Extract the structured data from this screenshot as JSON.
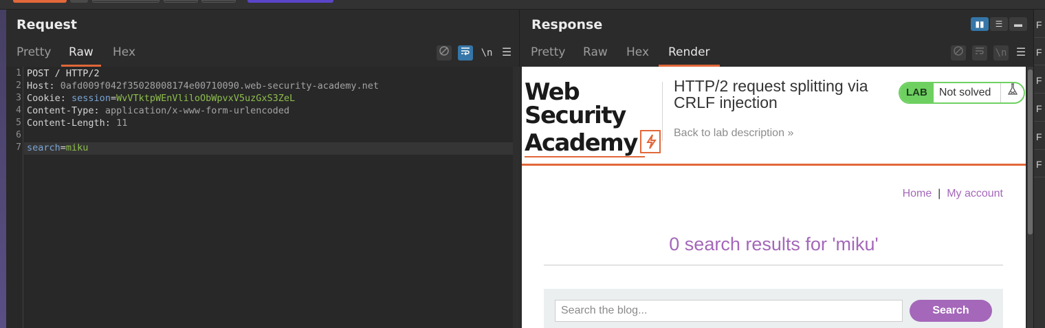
{
  "colors": {
    "accent": "#e2673a",
    "toggle_on": "#3676a8",
    "link_purple": "#a467b9",
    "lab_green": "#6ed061"
  },
  "request": {
    "title": "Request",
    "tabs": [
      "Pretty",
      "Raw",
      "Hex"
    ],
    "active_tab": "Raw",
    "tools": {
      "hide_icon": "eye-slash-icon",
      "wrap_icon": "wrap-lines-icon",
      "newline_label": "\\n",
      "menu_icon": "hamburger-icon"
    },
    "line_numbers": [
      "1",
      "2",
      "3",
      "4",
      "5",
      "6",
      "7"
    ],
    "lines": {
      "l1": "POST / HTTP/2",
      "l2_key": "Host:",
      "l2_val": "0afd009f042f35028008174e00710090.web-security-academy.net",
      "l3_key": "Cookie:",
      "l3_param": "session",
      "l3_eq": "=",
      "l3_val": "WvVTktpWEnVliloObWpvxV5uzGxS3ZeL",
      "l4_key": "Content-Type:",
      "l4_val": "application/x-www-form-urlencoded",
      "l5_key": "Content-Length:",
      "l5_val": "11",
      "l6": "",
      "l7_param": "search",
      "l7_eq": "=",
      "l7_val": "miku"
    }
  },
  "response": {
    "title": "Response",
    "tabs": [
      "Pretty",
      "Raw",
      "Hex",
      "Render"
    ],
    "active_tab": "Render",
    "layout_toggles": [
      "side-by-side-icon",
      "stacked-icon",
      "single-pane-icon"
    ],
    "render": {
      "logo_line1": "Web Security",
      "logo_line2": "Academy",
      "lab_title": "HTTP/2 request splitting via CRLF injection",
      "back_link": "Back to lab description",
      "lab_badge": "LAB",
      "lab_status": "Not solved",
      "nav_home": "Home",
      "nav_sep": "|",
      "nav_account": "My account",
      "results_heading": "0 search results for 'miku'",
      "search_placeholder": "Search the blog...",
      "search_button": "Search"
    }
  },
  "right_strip_items": [
    "F",
    "F",
    "F",
    "F",
    "F",
    "F"
  ]
}
